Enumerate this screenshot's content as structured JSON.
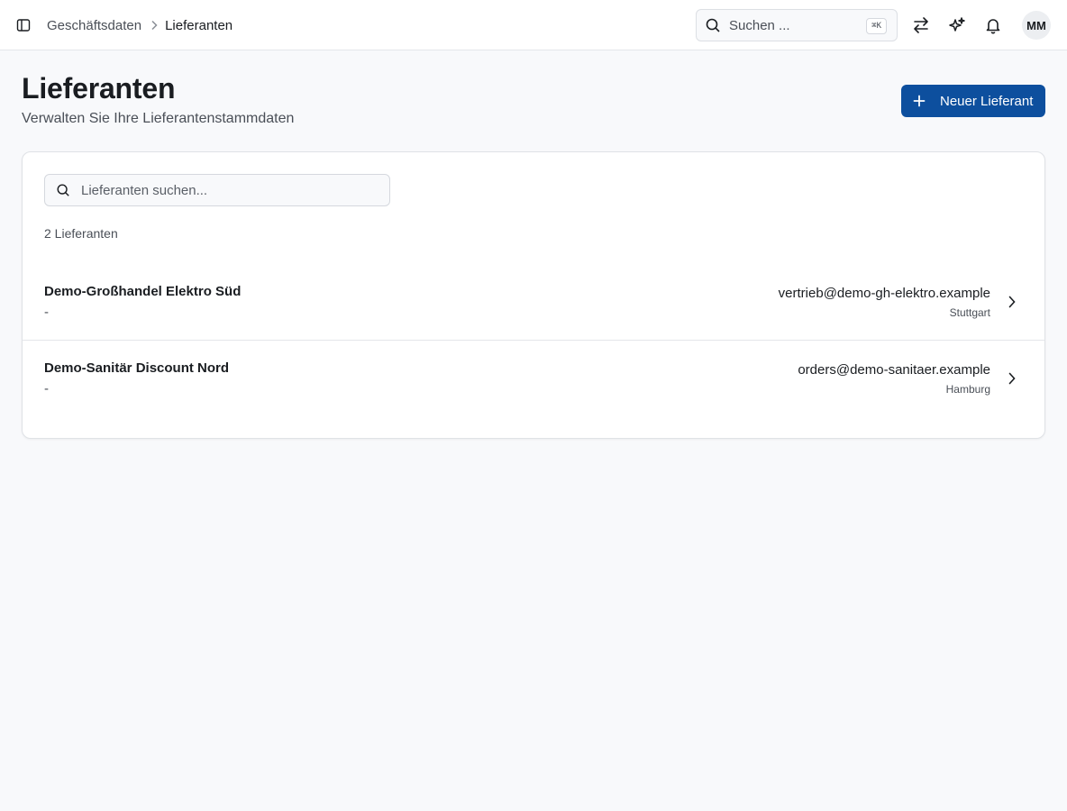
{
  "breadcrumb": {
    "parent": "Geschäftsdaten",
    "current": "Lieferanten"
  },
  "global_search": {
    "placeholder": "Suchen ...",
    "shortcut": "⌘K"
  },
  "user": {
    "initials": "MM"
  },
  "header": {
    "title": "Lieferanten",
    "subtitle": "Verwalten Sie Ihre Lieferantenstammdaten",
    "new_button_label": "Neuer Lieferant"
  },
  "list": {
    "search_placeholder": "Lieferanten suchen...",
    "count_label": "2 Lieferanten",
    "rows": [
      {
        "name": "Demo-Großhandel Elektro Süd",
        "sub": "-",
        "email": "vertrieb@demo-gh-elektro.example",
        "city": "Stuttgart"
      },
      {
        "name": "Demo-Sanitär Discount Nord",
        "sub": "-",
        "email": "orders@demo-sanitaer.example",
        "city": "Hamburg"
      }
    ]
  },
  "icons": {
    "sidebar_toggle": "sidebar-toggle-icon",
    "switch": "arrows-switch-icon",
    "ai": "sparkles-icon",
    "notifications": "bell-icon",
    "search": "search-icon",
    "chevron": "chevron-right-icon",
    "plus": "plus-icon"
  },
  "colors": {
    "primary": "#0d4f9e",
    "background": "#f8f9fb",
    "text": "#1a1d21"
  }
}
